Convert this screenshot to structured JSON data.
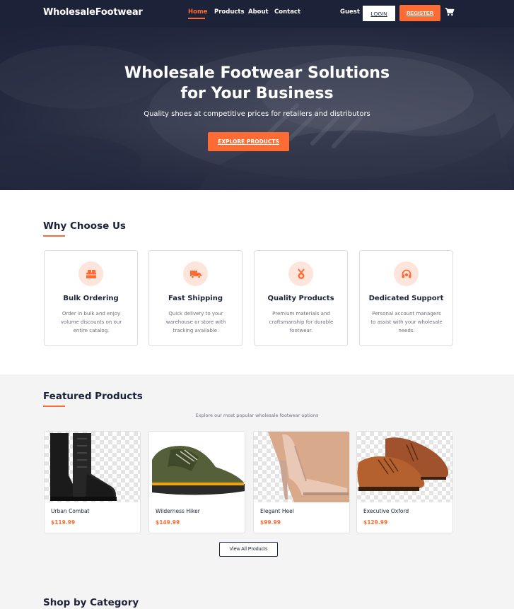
{
  "nav": {
    "brand": "WholesaleFootwear",
    "links": [
      "Home",
      "Products",
      "About",
      "Contact"
    ],
    "active_link": "Home",
    "guest_label": "Guest",
    "login_label": "LOGIN",
    "register_label": "REGISTER",
    "cart_icon": "cart-icon"
  },
  "hero": {
    "title_line1": "Wholesale Footwear Solutions",
    "title_line2": "for Your Business",
    "subtitle": "Quality shoes at competitive prices for retailers and distributors",
    "cta_label": "EXPLORE PRODUCTS"
  },
  "why": {
    "title": "Why Choose Us",
    "features": [
      {
        "icon": "boxes-icon",
        "title": "Bulk Ordering",
        "desc": "Order in bulk and enjoy volume discounts on our entire catalog."
      },
      {
        "icon": "truck-icon",
        "title": "Fast Shipping",
        "desc": "Quick delivery to your warehouse or store with tracking available."
      },
      {
        "icon": "medal-icon",
        "title": "Quality Products",
        "desc": "Premium materials and craftsmanship for durable footwear."
      },
      {
        "icon": "headset-icon",
        "title": "Dedicated Support",
        "desc": "Personal account managers to assist with your wholesale needs."
      }
    ]
  },
  "featured": {
    "title": "Featured Products",
    "subtitle": "Explore our most popular wholesale footwear options",
    "products": [
      {
        "name": "Urban Combat",
        "price": "$119.99"
      },
      {
        "name": "Wilderness Hiker",
        "price": "$149.99"
      },
      {
        "name": "Elegant Heel",
        "price": "$99.99"
      },
      {
        "name": "Executive Oxford",
        "price": "$129.99"
      }
    ],
    "view_all_label": "View All Products"
  },
  "category": {
    "title": "Shop by Category"
  },
  "colors": {
    "navy": "#1c2238",
    "accent": "#ff6b35",
    "accent_soft": "#fde5dc"
  }
}
